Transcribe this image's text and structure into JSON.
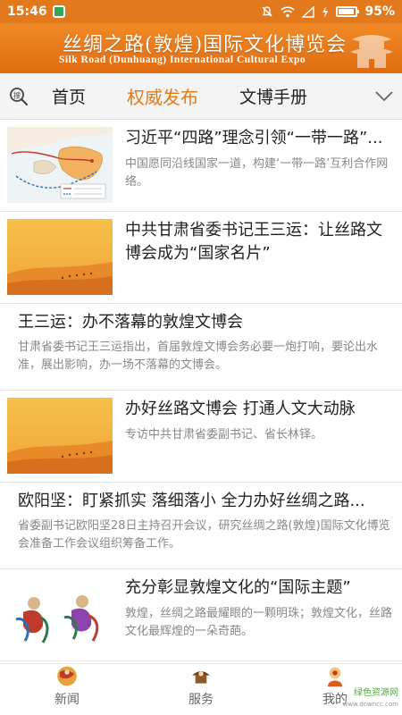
{
  "status": {
    "time": "15:46",
    "battery": "95%",
    "battery_level": 0.95
  },
  "banner": {
    "title_cn": "丝绸之路(敦煌)国际文化博览会",
    "title_en": "Silk Road (Dunhuang) International Cultural Expo"
  },
  "tabs": [
    {
      "label": "首页"
    },
    {
      "label": "权威发布"
    },
    {
      "label": "文博手册"
    }
  ],
  "feed": [
    {
      "title": "习近平“四路”理念引领“一带一路”...",
      "summary": "中国愿同沿线国家一道，构建‘一带一路’互利合作网络。"
    },
    {
      "title": "中共甘肃省委书记王三运：让丝路文博会成为“国家名片”",
      "summary": ""
    },
    {
      "title": "王三运：办不落幕的敦煌文博会",
      "summary": "甘肃省委书记王三运指出，首届敦煌文博会务必要一炮打响，要论出水准，展出影响，办一场不落幕的文博会。"
    },
    {
      "title": "办好丝路文博会 打通人文大动脉",
      "summary": "专访中共甘肃省委副书记、省长林铎。"
    },
    {
      "title": "欧阳坚：盯紧抓实 落细落小 全力办好丝绸之路...",
      "summary": "省委副书记欧阳坚28日主持召开会议，研究丝绸之路(敦煌)国际文化博览会准备工作会议组织筹备工作。"
    },
    {
      "title": "充分彰显敦煌文化的“国际主题”",
      "summary": "敦煌，丝绸之路最耀眼的一颗明珠；敦煌文化，丝路文化最辉煌的一朵奇葩。"
    }
  ],
  "bottom_nav": [
    {
      "label": "新闻"
    },
    {
      "label": "服务"
    },
    {
      "label": "我的"
    }
  ],
  "watermark": {
    "text": "绿色资源网",
    "url": "www.downcc.com"
  },
  "colors": {
    "accent": "#e07b1b",
    "banner": "#e8791a",
    "status_bar": "#e2791c"
  },
  "icons": {
    "search": "search-icon",
    "chevron": "chevron-down-icon"
  }
}
